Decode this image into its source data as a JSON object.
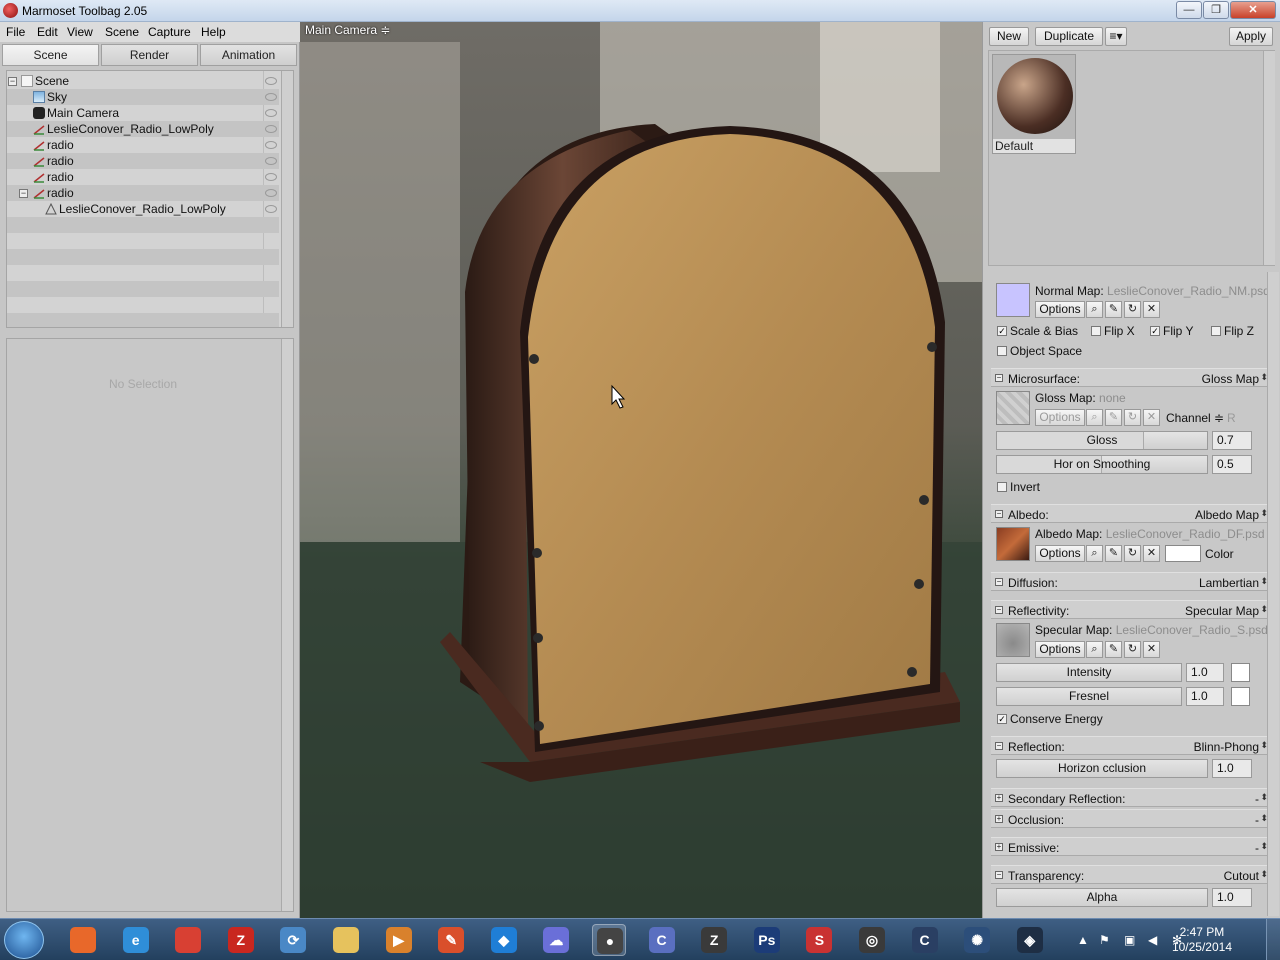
{
  "window": {
    "title": "Marmoset Toolbag 2.05",
    "minimize": "—",
    "maximize": "❐",
    "close": "✕"
  },
  "menu": [
    "File",
    "Edit",
    "View",
    "Scene",
    "Capture",
    "Help"
  ],
  "left_tabs": [
    "Scene",
    "Render",
    "Animation"
  ],
  "scene_tree": [
    {
      "label": "Scene",
      "icon": "scene-icon"
    },
    {
      "label": "Sky",
      "icon": "sky-icon"
    },
    {
      "label": "Main Camera",
      "icon": "camera-icon"
    },
    {
      "label": "LeslieConover_Radio_LowPoly",
      "icon": "mesh-icon"
    },
    {
      "label": "radio",
      "icon": "mesh-icon"
    },
    {
      "label": "radio",
      "icon": "mesh-icon"
    },
    {
      "label": "radio",
      "icon": "mesh-icon"
    },
    {
      "label": "radio",
      "icon": "mesh-icon"
    },
    {
      "label": "LeslieConover_Radio_LowPoly",
      "icon": "material-icon"
    }
  ],
  "no_selection": "No Selection",
  "viewport": {
    "camera_label": "Main Camera ≑"
  },
  "material": {
    "new_label": "New",
    "duplicate_label": "Duplicate",
    "menu_glyph": "≡▾",
    "apply_label": "Apply",
    "preview_name": "Default"
  },
  "normal": {
    "map_label": "Normal Map:",
    "file": "LeslieConover_Radio_NM.psd",
    "options": "Options",
    "scale_bias": "Scale & Bias",
    "flip_x": "Flip X",
    "flip_y": "Flip Y",
    "flip_z": "Flip Z",
    "object_space": "Object Space"
  },
  "microsurface": {
    "name": "Microsurface:",
    "value": "Gloss Map",
    "map_label": "Gloss Map:",
    "file": "none",
    "options": "Options",
    "channel_label": "Channel ≑",
    "channel_value": "R",
    "gloss_label": "Gloss",
    "gloss_value": "0.7",
    "gloss_fraction": 0.7,
    "horizon_label": "Hor  on Smoothing",
    "horizon_value": "0.5",
    "horizon_fraction": 0.5,
    "invert": "Invert"
  },
  "albedo": {
    "name": "Albedo:",
    "value": "Albedo Map",
    "map_label": "Albedo Map:",
    "file": "LeslieConover_Radio_DF.psd",
    "options": "Options",
    "color_label": "Color"
  },
  "diffusion": {
    "name": "Diffusion:",
    "value": "Lambertian"
  },
  "reflectivity": {
    "name": "Reflectivity:",
    "value": "Specular Map",
    "map_label": "Specular Map:",
    "file": "LeslieConover_Radio_S.psd",
    "options": "Options",
    "intensity_label": "Intensity",
    "intensity_value": "1.0",
    "fresnel_label": "Fresnel",
    "fresnel_value": "1.0",
    "conserve": "Conserve Energy"
  },
  "reflection": {
    "name": "Reflection:",
    "value": "Blinn-Phong",
    "horizon_label": "Horizon  cclusion",
    "horizon_value": "1.0"
  },
  "secondary_reflection": {
    "name": "Secondary Reflection:",
    "value": "-"
  },
  "occlusion": {
    "name": "Occlusion:",
    "value": "-"
  },
  "emissive": {
    "name": "Emissive:",
    "value": "-"
  },
  "transparency": {
    "name": "Transparency:",
    "value": "Cutout",
    "alpha_label": "Alpha",
    "alpha_value": "1.0"
  },
  "taskbar": {
    "apps": [
      {
        "name": "firefox-icon",
        "glyph": "",
        "color": "#e8682a"
      },
      {
        "name": "internet-explorer-icon",
        "glyph": "e",
        "color": "#2f8ed8"
      },
      {
        "name": "chrome-icon",
        "glyph": "",
        "color": "#d84033"
      },
      {
        "name": "filezilla-icon",
        "glyph": "Z",
        "color": "#c9271f"
      },
      {
        "name": "sync-icon",
        "glyph": "⟳",
        "color": "#4a88c6"
      },
      {
        "name": "folder-icon",
        "glyph": "",
        "color": "#e6c25d"
      },
      {
        "name": "media-player-icon",
        "glyph": "▶",
        "color": "#d9812c"
      },
      {
        "name": "paint-icon",
        "glyph": "✎",
        "color": "#d94f2b"
      },
      {
        "name": "dropbox-icon",
        "glyph": "◆",
        "color": "#1f7ed6"
      },
      {
        "name": "cloud-icon",
        "glyph": "☁",
        "color": "#6a6fd8"
      },
      {
        "name": "marmoset-icon",
        "glyph": "●",
        "color": "#444444"
      },
      {
        "name": "crysis-icon",
        "glyph": "C",
        "color": "#5a6fc0"
      },
      {
        "name": "zbrush-icon",
        "glyph": "Z",
        "color": "#3a3a3a"
      },
      {
        "name": "photoshop-icon",
        "glyph": "Ps",
        "color": "#1c3c78"
      },
      {
        "name": "substance-icon",
        "glyph": "S",
        "color": "#c93232"
      },
      {
        "name": "unity-icon",
        "glyph": "◎",
        "color": "#3a3a3a"
      },
      {
        "name": "cinema-icon",
        "glyph": "C",
        "color": "#2a3f63"
      },
      {
        "name": "xnormal-icon",
        "glyph": "✺",
        "color": "#2c4e7a"
      },
      {
        "name": "unreal-icon",
        "glyph": "◈",
        "color": "#1e2e44"
      }
    ],
    "time": "2:47 PM",
    "date": "10/25/2014"
  }
}
